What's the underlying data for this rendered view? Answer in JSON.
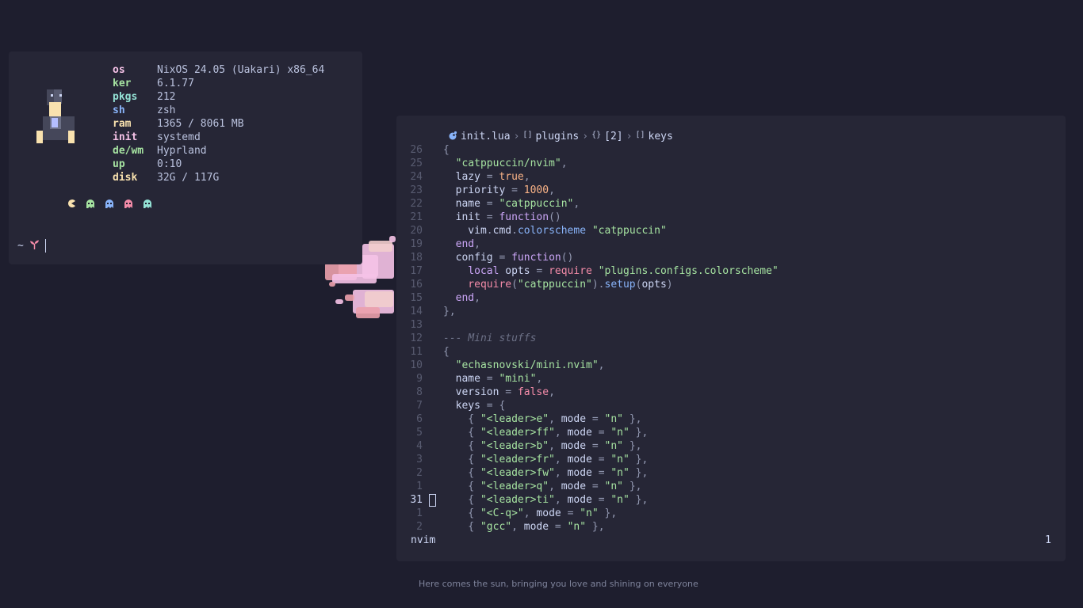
{
  "colors": {
    "background": "#1e1e2e",
    "panel": "#262636",
    "text": "#cdd6f4",
    "accent_pink": "#f5c2e7",
    "accent_green": "#a6e3a1",
    "accent_blue": "#89b4fa",
    "accent_yellow": "#f9e2af",
    "accent_peach": "#fab387",
    "accent_teal": "#94e2d5"
  },
  "fetch": {
    "rows": [
      {
        "key": "os",
        "value": "NixOS 24.05 (Uakari) x86_64",
        "color": "#f5c2e7"
      },
      {
        "key": "ker",
        "value": "6.1.77",
        "color": "#a6e3a1"
      },
      {
        "key": "pkgs",
        "value": "212",
        "color": "#94e2d5"
      },
      {
        "key": "sh",
        "value": "zsh",
        "color": "#89b4fa"
      },
      {
        "key": "ram",
        "value": "1365 / 8061 MB",
        "color": "#f9e2af"
      },
      {
        "key": "init",
        "value": "systemd",
        "color": "#f5c2e7"
      },
      {
        "key": "de/wm",
        "value": "Hyprland",
        "color": "#a6e3a1"
      },
      {
        "key": "up",
        "value": "0:10",
        "color": "#a6e3a1"
      },
      {
        "key": "disk",
        "value": "32G / 117G",
        "color": "#f9e2af"
      }
    ],
    "dot_icons": [
      "pacman-icon",
      "ghost-green-icon",
      "ghost-blue-icon",
      "ghost-red-icon",
      "ghost-teal-icon"
    ]
  },
  "prompt": {
    "symbol": "~",
    "icon": "sprout-icon"
  },
  "nvim": {
    "winbar": {
      "file": "init.lua",
      "crumbs": [
        {
          "icon": "[]",
          "label": "plugins"
        },
        {
          "icon": "{}",
          "label": "[2]"
        },
        {
          "icon": "[]",
          "label": "keys"
        }
      ]
    },
    "lines": [
      {
        "n": "26",
        "cur": false,
        "tokens": [
          [
            "pun",
            "{"
          ]
        ]
      },
      {
        "n": "25",
        "cur": false,
        "tokens": [
          [
            "pun",
            "  "
          ],
          [
            "str",
            "\"catppuccin/nvim\""
          ],
          [
            "pun",
            ","
          ]
        ]
      },
      {
        "n": "24",
        "cur": false,
        "tokens": [
          [
            "id",
            "  lazy "
          ],
          [
            "pun",
            "= "
          ],
          [
            "bool",
            "true"
          ],
          [
            "pun",
            ","
          ]
        ]
      },
      {
        "n": "23",
        "cur": false,
        "tokens": [
          [
            "id",
            "  priority "
          ],
          [
            "pun",
            "= "
          ],
          [
            "num",
            "1000"
          ],
          [
            "pun",
            ","
          ]
        ]
      },
      {
        "n": "22",
        "cur": false,
        "tokens": [
          [
            "id",
            "  name "
          ],
          [
            "pun",
            "= "
          ],
          [
            "str",
            "\"catppuccin\""
          ],
          [
            "pun",
            ","
          ]
        ]
      },
      {
        "n": "21",
        "cur": false,
        "tokens": [
          [
            "id",
            "  init "
          ],
          [
            "pun",
            "= "
          ],
          [
            "kw",
            "function"
          ],
          [
            "pun",
            "()"
          ]
        ]
      },
      {
        "n": "20",
        "cur": false,
        "tokens": [
          [
            "id",
            "    vim"
          ],
          [
            "pun",
            "."
          ],
          [
            "id",
            "cmd"
          ],
          [
            "pun",
            "."
          ],
          [
            "fn",
            "colorscheme "
          ],
          [
            "str",
            "\"catppuccin\""
          ]
        ]
      },
      {
        "n": "19",
        "cur": false,
        "tokens": [
          [
            "kw",
            "  end"
          ],
          [
            "pun",
            ","
          ]
        ]
      },
      {
        "n": "18",
        "cur": false,
        "tokens": [
          [
            "id",
            "  config "
          ],
          [
            "pun",
            "= "
          ],
          [
            "kw",
            "function"
          ],
          [
            "pun",
            "()"
          ]
        ]
      },
      {
        "n": "17",
        "cur": false,
        "tokens": [
          [
            "kw",
            "    local "
          ],
          [
            "id",
            "opts "
          ],
          [
            "pun",
            "= "
          ],
          [
            "req",
            "require "
          ],
          [
            "str",
            "\"plugins.configs.colorscheme\""
          ]
        ]
      },
      {
        "n": "16",
        "cur": false,
        "tokens": [
          [
            "req",
            "    require"
          ],
          [
            "pun",
            "("
          ],
          [
            "str",
            "\"catppuccin\""
          ],
          [
            "pun",
            ")."
          ],
          [
            "fn",
            "setup"
          ],
          [
            "pun",
            "("
          ],
          [
            "id",
            "opts"
          ],
          [
            "pun",
            ")"
          ]
        ]
      },
      {
        "n": "15",
        "cur": false,
        "tokens": [
          [
            "kw",
            "  end"
          ],
          [
            "pun",
            ","
          ]
        ]
      },
      {
        "n": "14",
        "cur": false,
        "tokens": [
          [
            "pun",
            "},"
          ]
        ]
      },
      {
        "n": "13",
        "cur": false,
        "tokens": []
      },
      {
        "n": "12",
        "cur": false,
        "tokens": [
          [
            "cmt",
            "--- Mini stuffs"
          ]
        ]
      },
      {
        "n": "11",
        "cur": false,
        "tokens": [
          [
            "pun",
            "{"
          ]
        ]
      },
      {
        "n": "10",
        "cur": false,
        "tokens": [
          [
            "pun",
            "  "
          ],
          [
            "str",
            "\"echasnovski/mini.nvim\""
          ],
          [
            "pun",
            ","
          ]
        ]
      },
      {
        "n": "9",
        "cur": false,
        "tokens": [
          [
            "id",
            "  name "
          ],
          [
            "pun",
            "= "
          ],
          [
            "str",
            "\"mini\""
          ],
          [
            "pun",
            ","
          ]
        ]
      },
      {
        "n": "8",
        "cur": false,
        "tokens": [
          [
            "id",
            "  version "
          ],
          [
            "pun",
            "= "
          ],
          [
            "req",
            "false"
          ],
          [
            "pun",
            ","
          ]
        ]
      },
      {
        "n": "7",
        "cur": false,
        "tokens": [
          [
            "id",
            "  keys "
          ],
          [
            "pun",
            "= {"
          ]
        ]
      },
      {
        "n": "6",
        "cur": false,
        "tokens": [
          [
            "pun",
            "    { "
          ],
          [
            "str",
            "\"<leader>e\""
          ],
          [
            "pun",
            ", "
          ],
          [
            "id",
            "mode "
          ],
          [
            "pun",
            "= "
          ],
          [
            "str",
            "\"n\""
          ],
          [
            "pun",
            " },"
          ]
        ]
      },
      {
        "n": "5",
        "cur": false,
        "tokens": [
          [
            "pun",
            "    { "
          ],
          [
            "str",
            "\"<leader>ff\""
          ],
          [
            "pun",
            ", "
          ],
          [
            "id",
            "mode "
          ],
          [
            "pun",
            "= "
          ],
          [
            "str",
            "\"n\""
          ],
          [
            "pun",
            " },"
          ]
        ]
      },
      {
        "n": "4",
        "cur": false,
        "tokens": [
          [
            "pun",
            "    { "
          ],
          [
            "str",
            "\"<leader>b\""
          ],
          [
            "pun",
            ", "
          ],
          [
            "id",
            "mode "
          ],
          [
            "pun",
            "= "
          ],
          [
            "str",
            "\"n\""
          ],
          [
            "pun",
            " },"
          ]
        ]
      },
      {
        "n": "3",
        "cur": false,
        "tokens": [
          [
            "pun",
            "    { "
          ],
          [
            "str",
            "\"<leader>fr\""
          ],
          [
            "pun",
            ", "
          ],
          [
            "id",
            "mode "
          ],
          [
            "pun",
            "= "
          ],
          [
            "str",
            "\"n\""
          ],
          [
            "pun",
            " },"
          ]
        ]
      },
      {
        "n": "2",
        "cur": false,
        "tokens": [
          [
            "pun",
            "    { "
          ],
          [
            "str",
            "\"<leader>fw\""
          ],
          [
            "pun",
            ", "
          ],
          [
            "id",
            "mode "
          ],
          [
            "pun",
            "= "
          ],
          [
            "str",
            "\"n\""
          ],
          [
            "pun",
            " },"
          ]
        ]
      },
      {
        "n": "1",
        "cur": false,
        "tokens": [
          [
            "pun",
            "    { "
          ],
          [
            "str",
            "\"<leader>q\""
          ],
          [
            "pun",
            ", "
          ],
          [
            "id",
            "mode "
          ],
          [
            "pun",
            "= "
          ],
          [
            "str",
            "\"n\""
          ],
          [
            "pun",
            " },"
          ]
        ]
      },
      {
        "n": "31",
        "cur": true,
        "tokens": [
          [
            "pun",
            "    { "
          ],
          [
            "str",
            "\"<leader>ti\""
          ],
          [
            "pun",
            ", "
          ],
          [
            "id",
            "mode "
          ],
          [
            "pun",
            "= "
          ],
          [
            "str",
            "\"n\""
          ],
          [
            "pun",
            " },"
          ]
        ]
      },
      {
        "n": "1",
        "cur": false,
        "tokens": [
          [
            "pun",
            "    { "
          ],
          [
            "str",
            "\"<C-q>\""
          ],
          [
            "pun",
            ", "
          ],
          [
            "id",
            "mode "
          ],
          [
            "pun",
            "= "
          ],
          [
            "str",
            "\"n\""
          ],
          [
            "pun",
            " },"
          ]
        ]
      },
      {
        "n": "2",
        "cur": false,
        "tokens": [
          [
            "pun",
            "    { "
          ],
          [
            "str",
            "\"gcc\""
          ],
          [
            "pun",
            ", "
          ],
          [
            "id",
            "mode "
          ],
          [
            "pun",
            "= "
          ],
          [
            "str",
            "\"n\""
          ],
          [
            "pun",
            " },"
          ]
        ]
      }
    ],
    "status": {
      "left": "nvim",
      "right": "1"
    }
  },
  "tagline": "Here comes the sun, bringing you love and shining on everyone"
}
